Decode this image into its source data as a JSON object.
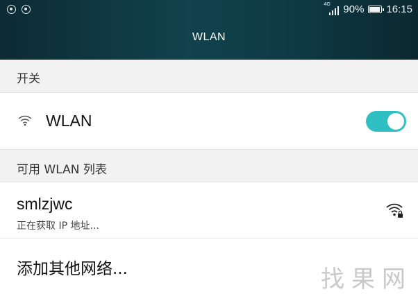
{
  "status_bar": {
    "network_type": "4G",
    "battery_percent": "90%",
    "battery_level": 0.9,
    "time": "16:15"
  },
  "header": {
    "title": "WLAN"
  },
  "switch_section": {
    "label": "开关"
  },
  "wlan_toggle": {
    "label": "WLAN",
    "enabled": true,
    "accent_color": "#2fbfc3"
  },
  "list_section": {
    "label": "可用 WLAN 列表"
  },
  "networks": [
    {
      "ssid": "smlzjwc",
      "status": "正在获取 IP 地址...",
      "icon": "wifi-lock-icon"
    }
  ],
  "add_network": {
    "label": "添加其他网络..."
  },
  "watermark": {
    "text": "找果网"
  }
}
